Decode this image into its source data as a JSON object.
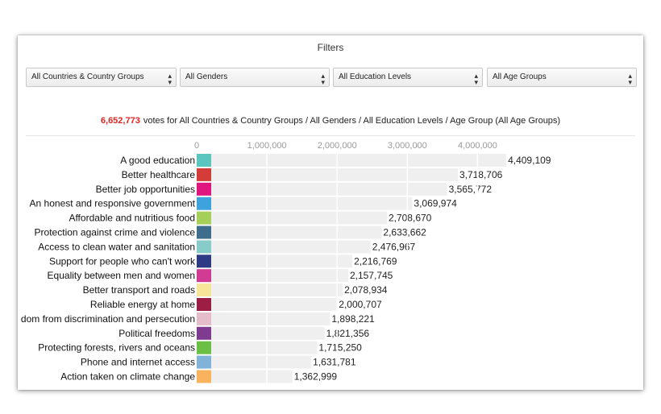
{
  "filters": {
    "title": "Filters",
    "selects": [
      {
        "value": "All Countries & Country Groups"
      },
      {
        "value": "All Genders"
      },
      {
        "value": "All Education Levels"
      },
      {
        "value": "All Age Groups"
      }
    ]
  },
  "summary": {
    "count": "6,652,773",
    "text": "votes for All Countries & Country Groups / All Genders / All Education Levels / Age Group (All Age Groups)"
  },
  "chart_data": {
    "type": "bar",
    "orientation": "horizontal",
    "xlim": [
      0,
      4500000
    ],
    "xticks": [
      {
        "value": 0,
        "label": "0"
      },
      {
        "value": 1000000,
        "label": "1,000,000"
      },
      {
        "value": 2000000,
        "label": "2,000,000"
      },
      {
        "value": 3000000,
        "label": "3,000,000"
      },
      {
        "value": 4000000,
        "label": "4,000,000"
      }
    ],
    "grid": true,
    "categories": [
      "A good education",
      "Better healthcare",
      "Better job opportunities",
      "An honest and responsive government",
      "Affordable and nutritious food",
      "Protection against crime and violence",
      "Access to clean water and sanitation",
      "Support for people who can't work",
      "Equality between men and women",
      "Better transport and roads",
      "Reliable energy at home",
      "dom from discrimination and persecution",
      "Political freedoms",
      "Protecting forests, rivers and oceans",
      "Phone and internet access",
      "Action taken on climate change"
    ],
    "values": [
      4409109,
      3718706,
      3565772,
      3069974,
      2708670,
      2633662,
      2476967,
      2216769,
      2157745,
      2078934,
      2000707,
      1898221,
      1821356,
      1715250,
      1631781,
      1362999
    ],
    "value_labels": [
      "4,409,109",
      "3,718,706",
      "3,565,772",
      "3,069,974",
      "2,708,670",
      "2,633,662",
      "2,476,967",
      "2,216,769",
      "2,157,745",
      "2,078,934",
      "2,000,707",
      "1,898,221",
      "1,821,356",
      "1,715,250",
      "1,631,781",
      "1,362,999"
    ],
    "swatch_colors": [
      "#5bc5c0",
      "#d43c3a",
      "#e0157f",
      "#3ea3dc",
      "#a6cf5a",
      "#3e6d8e",
      "#88ccc9",
      "#2e3a83",
      "#d13b94",
      "#f7e59a",
      "#9c1e45",
      "#e5bcc9",
      "#7e3b8f",
      "#6cbf45",
      "#80b3d7",
      "#f9b35e"
    ],
    "bar_color": "#efefef",
    "grid_color": "#ffffff"
  }
}
